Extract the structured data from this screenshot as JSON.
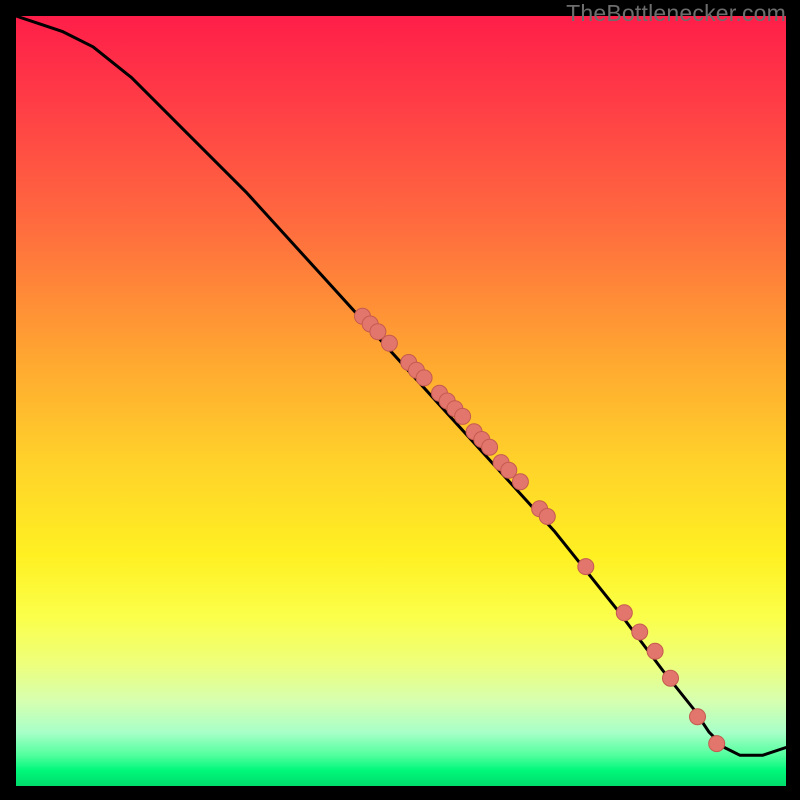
{
  "watermark": "TheBottlenecker.com",
  "colors": {
    "line": "#000000",
    "dot_fill": "#e2766d",
    "dot_stroke": "#c55a4f"
  },
  "chart_data": {
    "type": "line",
    "title": "",
    "xlabel": "",
    "ylabel": "",
    "xlim": [
      0,
      100
    ],
    "ylim": [
      0,
      100
    ],
    "series": [
      {
        "name": "curve",
        "x": [
          0,
          3,
          6,
          10,
          15,
          20,
          30,
          40,
          50,
          60,
          70,
          78,
          84,
          88,
          90,
          92,
          94,
          97,
          100
        ],
        "y": [
          100,
          99,
          98,
          96,
          92,
          87,
          77,
          66,
          55,
          44,
          33,
          23,
          15,
          10,
          7,
          5,
          4,
          4,
          5
        ]
      }
    ],
    "points": [
      {
        "x": 45,
        "y": 61
      },
      {
        "x": 46,
        "y": 60
      },
      {
        "x": 47,
        "y": 59
      },
      {
        "x": 48.5,
        "y": 57.5
      },
      {
        "x": 51,
        "y": 55
      },
      {
        "x": 52,
        "y": 54
      },
      {
        "x": 53,
        "y": 53
      },
      {
        "x": 55,
        "y": 51
      },
      {
        "x": 56,
        "y": 50
      },
      {
        "x": 57,
        "y": 49
      },
      {
        "x": 58,
        "y": 48
      },
      {
        "x": 59.5,
        "y": 46
      },
      {
        "x": 60.5,
        "y": 45
      },
      {
        "x": 61.5,
        "y": 44
      },
      {
        "x": 63,
        "y": 42
      },
      {
        "x": 64,
        "y": 41
      },
      {
        "x": 65.5,
        "y": 39.5
      },
      {
        "x": 68,
        "y": 36
      },
      {
        "x": 69,
        "y": 35
      },
      {
        "x": 74,
        "y": 28.5
      },
      {
        "x": 79,
        "y": 22.5
      },
      {
        "x": 81,
        "y": 20
      },
      {
        "x": 83,
        "y": 17.5
      },
      {
        "x": 85,
        "y": 14
      },
      {
        "x": 88.5,
        "y": 9
      },
      {
        "x": 91,
        "y": 5.5
      }
    ]
  }
}
